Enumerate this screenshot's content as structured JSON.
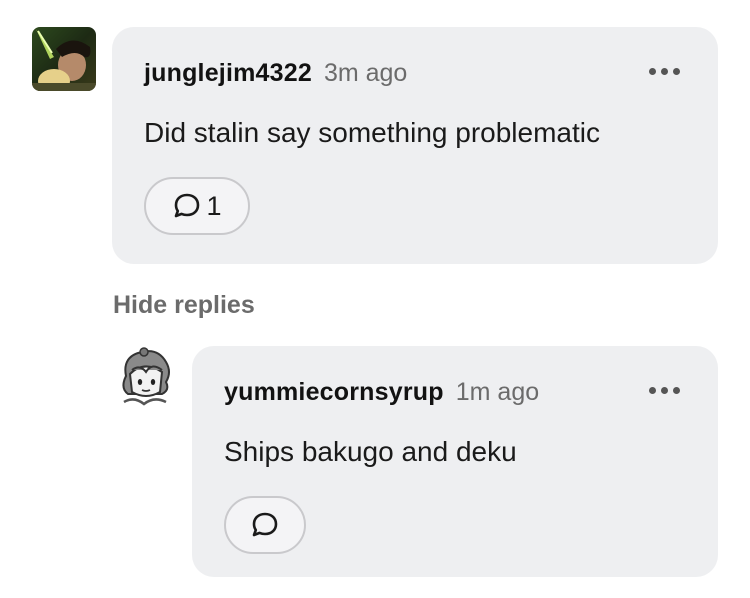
{
  "comments": [
    {
      "username": "junglejim4322",
      "time": "3m ago",
      "text": "Did stalin say something problematic",
      "reply_count": "1",
      "avatar_icon": "user-avatar-photo",
      "more_icon": "more-horizontal-icon"
    }
  ],
  "hide_replies_label": "Hide replies",
  "replies": [
    {
      "username": "yummiecornsyrup",
      "time": "1m ago",
      "text": "Ships bakugo and deku",
      "reply_count": "",
      "avatar_icon": "user-avatar-drawing",
      "more_icon": "more-horizontal-icon"
    }
  ],
  "colors": {
    "bubble_bg": "#eeeff1",
    "muted_text": "#6b6b6b",
    "button_border": "#c9c9cc"
  }
}
